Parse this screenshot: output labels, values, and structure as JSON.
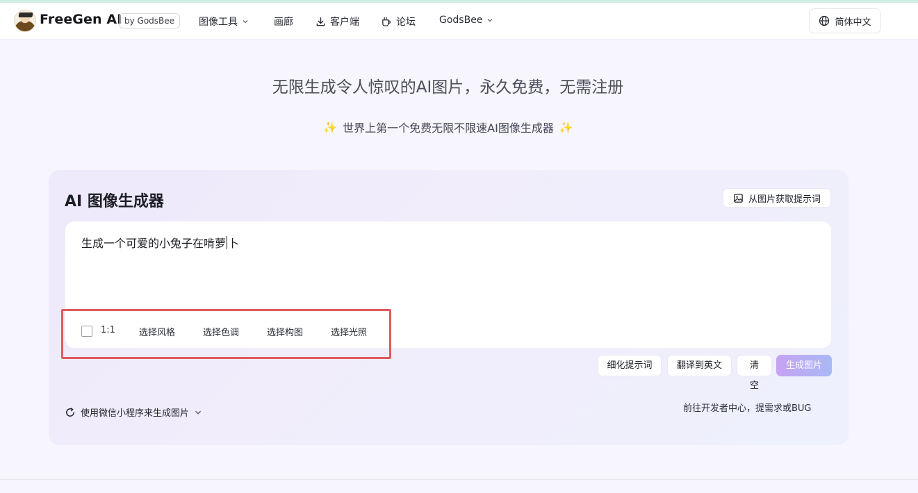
{
  "header": {
    "brand": "FreeGen AI",
    "by_badge": "by GodsBee",
    "nav": {
      "image_tools": "图像工具",
      "gallery": "画廊",
      "client": "客户端",
      "forum": "论坛",
      "godsbee": "GodsBee"
    },
    "language": "简体中文"
  },
  "hero": {
    "title": "无限生成令人惊叹的AI图片，永久免费，无需注册",
    "subtitle": "世界上第一个免费无限不限速AI图像生成器"
  },
  "generator": {
    "title": "AI 图像生成器",
    "image_to_prompt": "从图片获取提示词",
    "prompt_value_before_caret": "生成一个可爱的小兔子在啃萝",
    "prompt_value_after_caret": "卜",
    "options": {
      "ratio": "1:1",
      "style": "选择风格",
      "color": "选择色调",
      "composition": "选择构图",
      "lighting": "选择光照"
    },
    "actions": {
      "refine": "细化提示词",
      "translate": "翻译到英文",
      "clear": "清空",
      "generate": "生成图片"
    },
    "wechat": "使用微信小程序来生成图片",
    "dev_link": "前往开发者中心，提需求或BUG"
  },
  "colors": {
    "highlight_border": "#e05a5f",
    "generate_gradient_start": "#c6a3f3",
    "generate_gradient_end": "#a9b8f5",
    "sparkle": "#f2b84b"
  },
  "icons": [
    "logo-avatar",
    "chevron-down-icon",
    "download-icon",
    "coffee-cup-icon",
    "globe-icon",
    "image-icon",
    "sparkle-icon",
    "refresh-icon"
  ]
}
